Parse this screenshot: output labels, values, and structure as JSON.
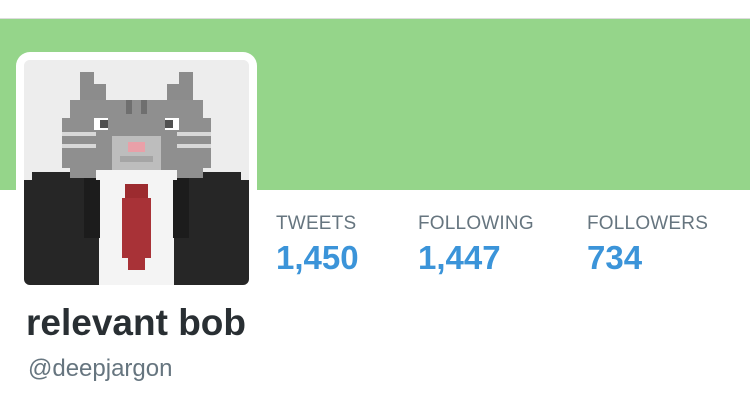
{
  "profile": {
    "name": "relevant bob",
    "handle": "@deepjargon",
    "banner_color": "#95d58a",
    "avatar_icon": "pixel-cat-in-suit-avatar"
  },
  "stats": [
    {
      "label": "TWEETS",
      "value": "1,450"
    },
    {
      "label": "FOLLOWING",
      "value": "1,447"
    },
    {
      "label": "FOLLOWERS",
      "value": "734"
    }
  ],
  "colors": {
    "accent": "#3b94d9",
    "muted_text": "#66757f",
    "name_text": "#292f33"
  }
}
